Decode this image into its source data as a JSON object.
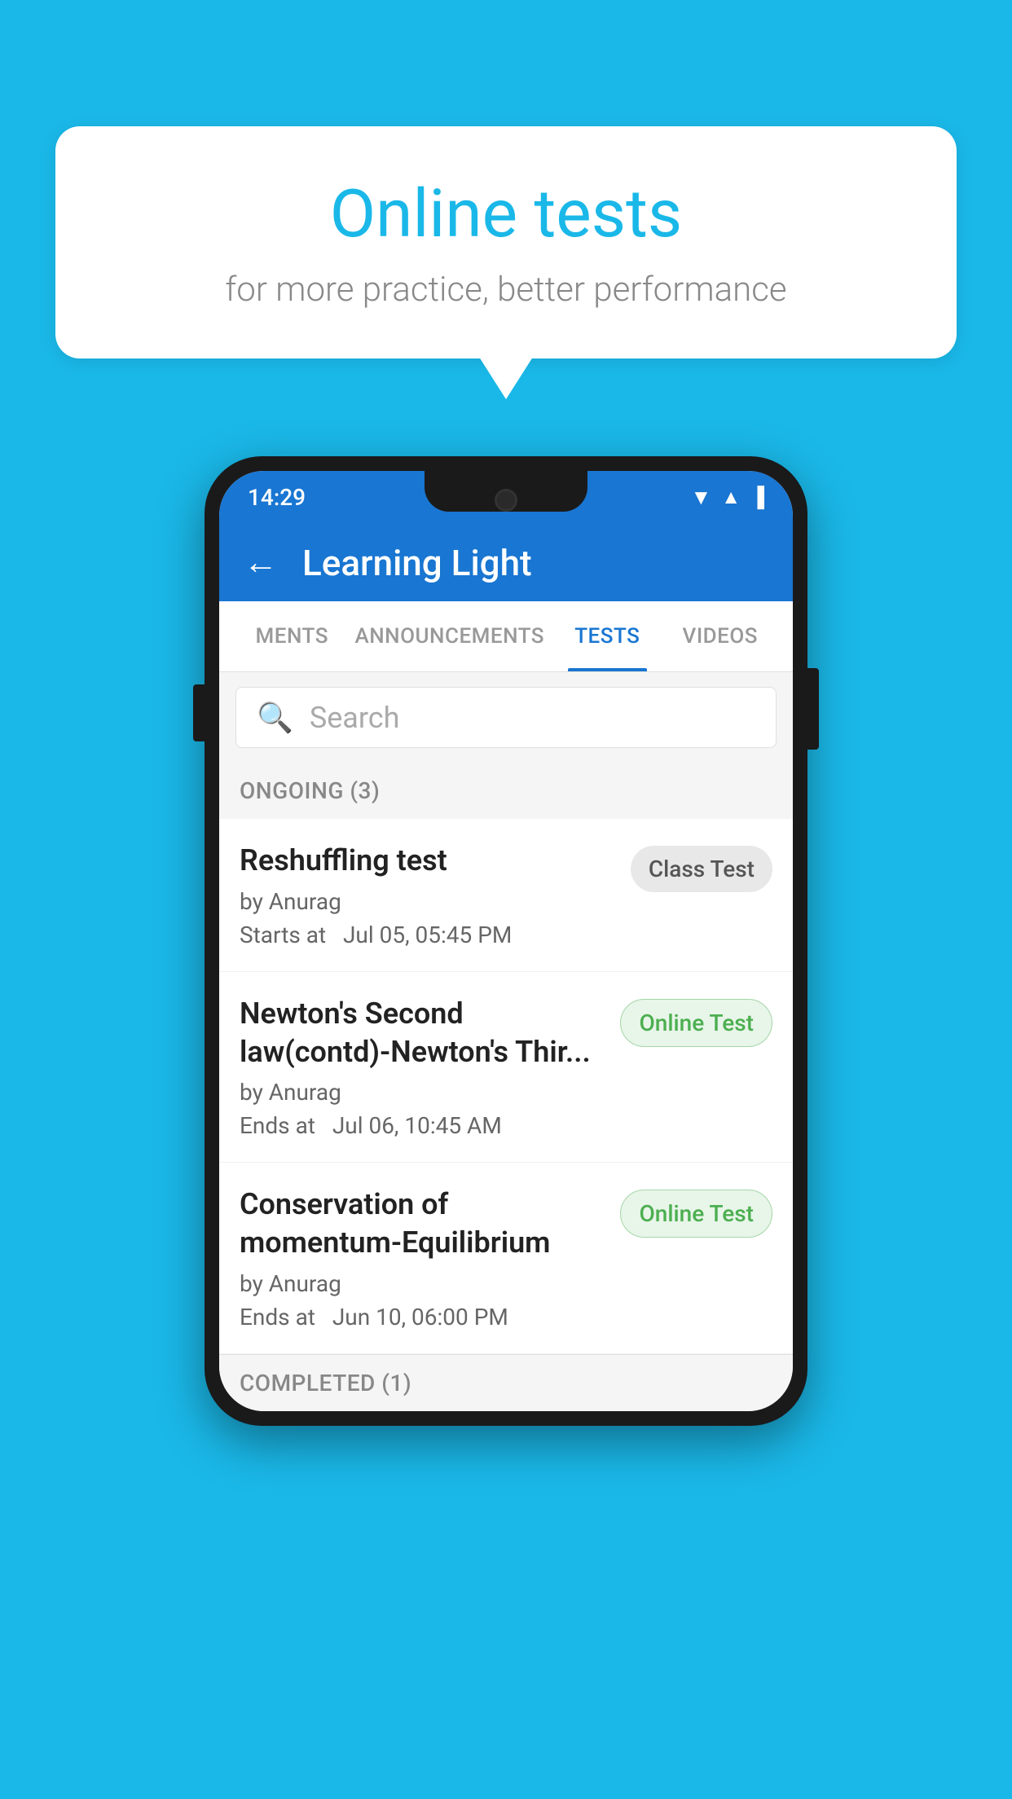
{
  "background_color": "#1ab8e8",
  "speech_bubble": {
    "title": "Online tests",
    "subtitle": "for more practice, better performance"
  },
  "phone": {
    "status_bar": {
      "time": "14:29",
      "wifi_symbol": "▼",
      "signal_symbol": "▲",
      "battery_symbol": "▮"
    },
    "app_header": {
      "back_label": "←",
      "title": "Learning Light"
    },
    "tabs": [
      {
        "label": "MENTS",
        "active": false
      },
      {
        "label": "ANNOUNCEMENTS",
        "active": false
      },
      {
        "label": "TESTS",
        "active": true
      },
      {
        "label": "VIDEOS",
        "active": false
      }
    ],
    "search": {
      "placeholder": "Search"
    },
    "ongoing_section": {
      "title": "ONGOING (3)"
    },
    "tests": [
      {
        "name": "Reshuffling test",
        "author": "by Anurag",
        "time_label": "Starts at",
        "time": "Jul 05, 05:45 PM",
        "badge": "Class Test",
        "badge_type": "class"
      },
      {
        "name": "Newton's Second law(contd)-Newton's Thir...",
        "author": "by Anurag",
        "time_label": "Ends at",
        "time": "Jul 06, 10:45 AM",
        "badge": "Online Test",
        "badge_type": "online"
      },
      {
        "name": "Conservation of momentum-Equilibrium",
        "author": "by Anurag",
        "time_label": "Ends at",
        "time": "Jun 10, 06:00 PM",
        "badge": "Online Test",
        "badge_type": "online"
      }
    ],
    "completed_section": {
      "title": "COMPLETED (1)"
    }
  }
}
